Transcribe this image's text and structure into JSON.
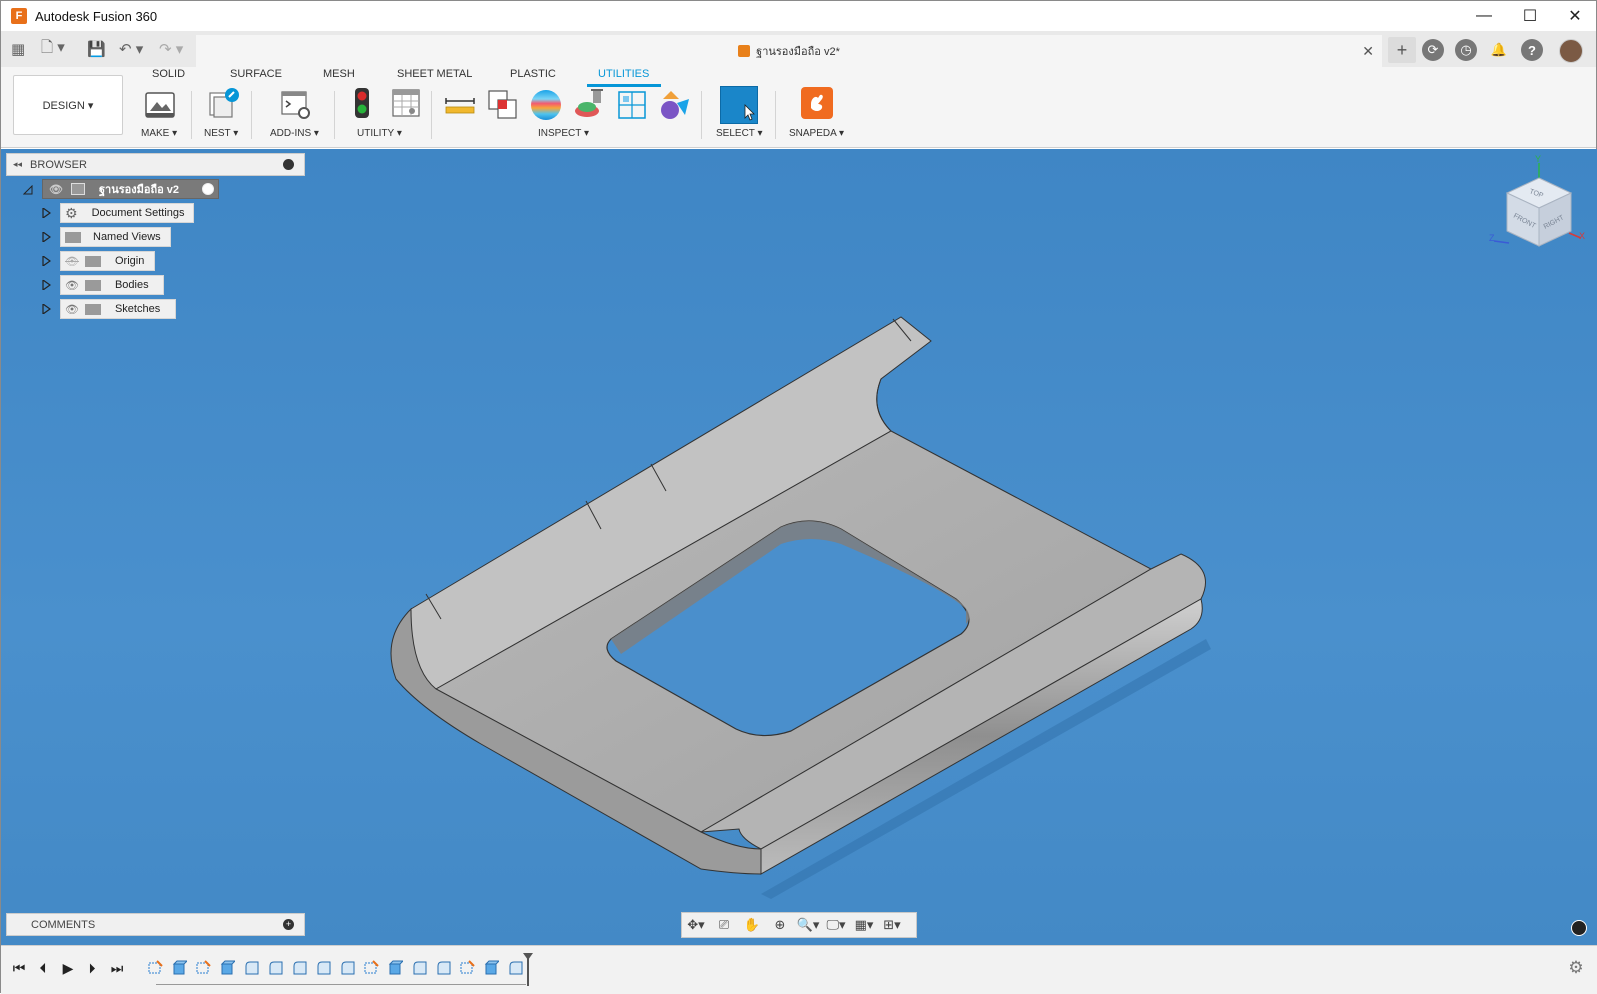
{
  "window": {
    "title": "Autodesk Fusion 360",
    "app_icon_letter": "F",
    "controls": {
      "minimize": "—",
      "maximize": "☐",
      "close": "✕"
    }
  },
  "document_tab": {
    "name": "ฐานรองมือถือ v2*",
    "close": "✕"
  },
  "quick_access": {
    "grid": "▦",
    "file": "🗋 ▾",
    "save": "💾",
    "undo": "↶ ▾",
    "redo": "↷ ▾"
  },
  "right_tools": {
    "new_tab": "+",
    "extensions": "⟳",
    "job_status": "◷",
    "notifications": "🔔",
    "help": "?"
  },
  "ribbon": {
    "workspace_button": "DESIGN ▾",
    "tabs": [
      {
        "label": "SOLID"
      },
      {
        "label": "SURFACE"
      },
      {
        "label": "MESH"
      },
      {
        "label": "SHEET METAL"
      },
      {
        "label": "PLASTIC"
      },
      {
        "label": "UTILITIES"
      }
    ],
    "active_tab": "UTILITIES",
    "groups": {
      "make": "MAKE ▾",
      "nest": "NEST ▾",
      "addins": "ADD-INS ▾",
      "utility": "UTILITY ▾",
      "inspect": "INSPECT ▾",
      "select": "SELECT ▾",
      "snapeda": "SNAPEDA ▾"
    }
  },
  "browser": {
    "header": "BROWSER",
    "root": "ฐานรองมือถือ v2",
    "items": [
      {
        "label": "Document Settings"
      },
      {
        "label": "Named Views"
      },
      {
        "label": "Origin"
      },
      {
        "label": "Bodies"
      },
      {
        "label": "Sketches"
      }
    ]
  },
  "comments": {
    "header": "COMMENTS"
  },
  "viewcube": {
    "top": "TOP",
    "front": "FRONT",
    "right": "RIGHT",
    "x": "X",
    "y": "Y",
    "z": "Z"
  },
  "navbar": {
    "orbit": "✥▾",
    "look": "⎚",
    "pan": "✋",
    "zoom": "⊕",
    "fit": "🔍▾",
    "display": "🖵▾",
    "grid": "▦▾",
    "viewports": "⊞▾"
  },
  "timeline": {
    "first": "⏮",
    "prev": "⏴",
    "play": "▶",
    "next": "⏵",
    "last": "⏭",
    "settings": "⚙"
  },
  "colors": {
    "accent": "#0696d7",
    "viewport": "#4a90cd",
    "model": "#a9a9a9",
    "snapeda": "#f06b20"
  }
}
